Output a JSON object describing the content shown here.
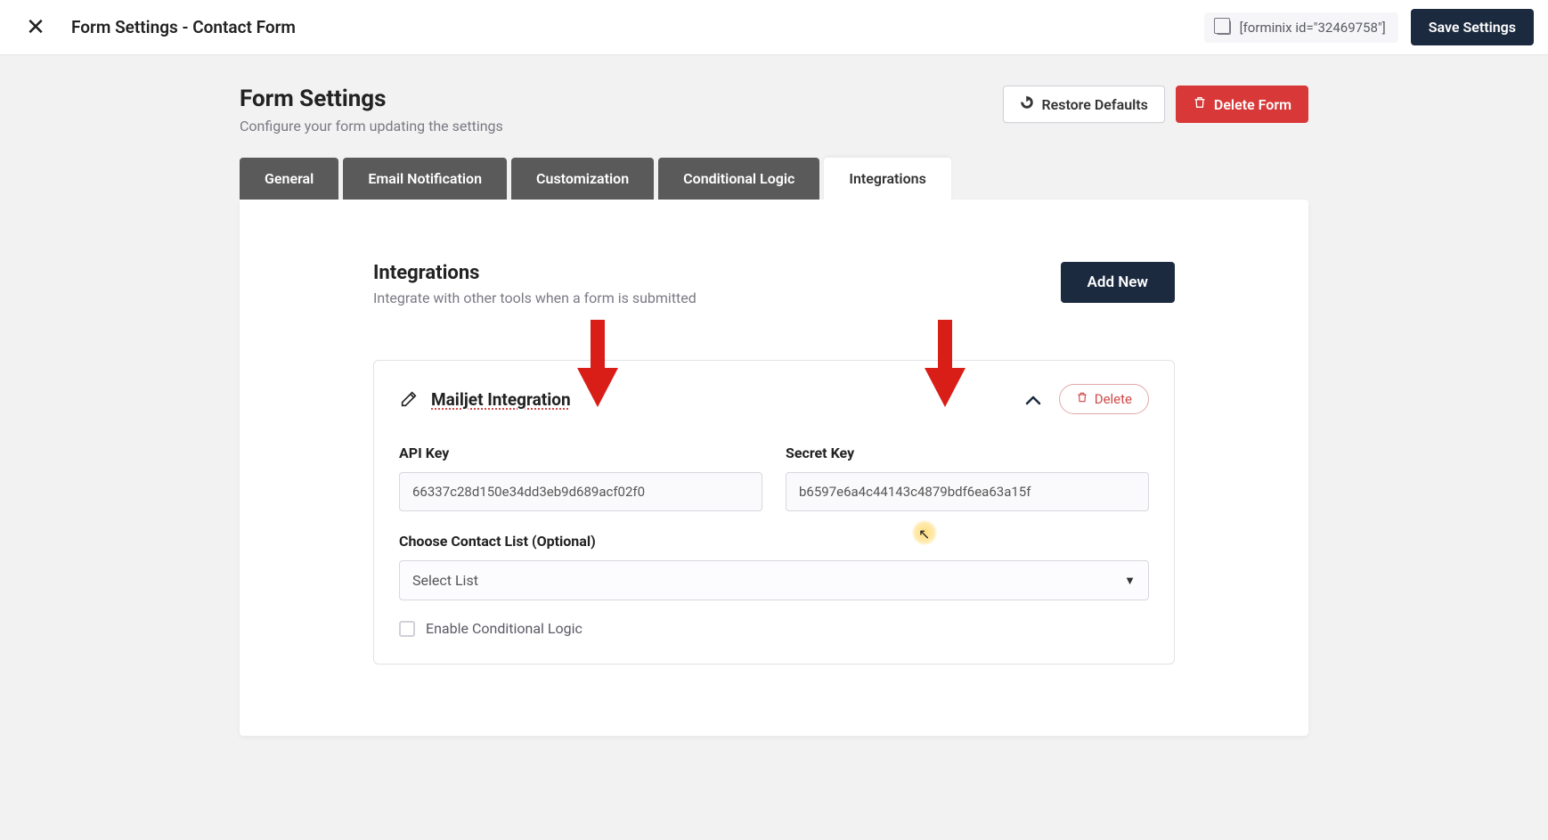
{
  "topbar": {
    "title": "Form Settings - Contact Form",
    "shortcode": "[forminix id=\"32469758\"]",
    "save_label": "Save Settings"
  },
  "page": {
    "title": "Form Settings",
    "subtitle": "Configure your form updating the settings",
    "restore_label": "Restore Defaults",
    "delete_label": "Delete Form"
  },
  "tabs": [
    {
      "label": "General",
      "active": false
    },
    {
      "label": "Email Notification",
      "active": false
    },
    {
      "label": "Customization",
      "active": false
    },
    {
      "label": "Conditional Logic",
      "active": false
    },
    {
      "label": "Integrations",
      "active": true
    }
  ],
  "panel": {
    "title": "Integrations",
    "subtitle": "Integrate with other tools when a form is submitted",
    "add_new_label": "Add New"
  },
  "integration": {
    "title": "Mailjet Integration",
    "delete_label": "Delete",
    "api_key": {
      "label": "API Key",
      "value": "66337c28d150e34dd3eb9d689acf02f0"
    },
    "secret_key": {
      "label": "Secret Key",
      "value": "b6597e6a4c44143c4879bdf6ea63a15f"
    },
    "contact_list": {
      "label": "Choose Contact List (Optional)",
      "selected": "Select List"
    },
    "conditional": {
      "label": "Enable Conditional Logic",
      "checked": false
    }
  },
  "annotations": {
    "arrow_color": "#d91e18"
  }
}
